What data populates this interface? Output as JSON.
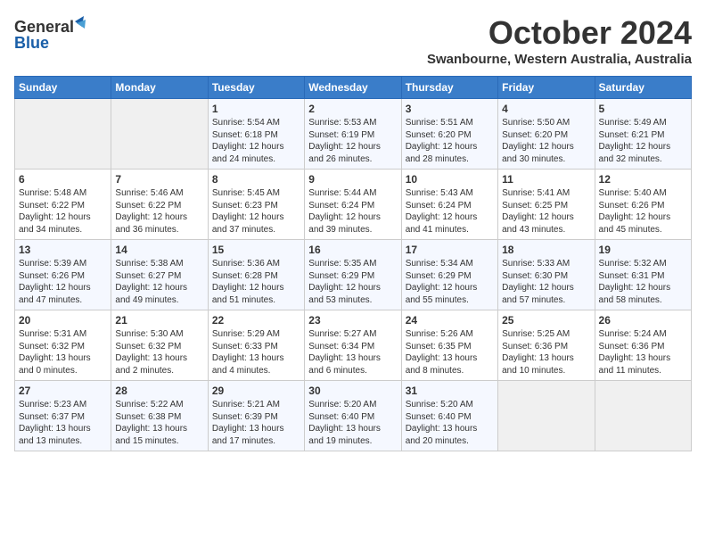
{
  "header": {
    "logo_line1": "General",
    "logo_line2": "Blue",
    "title": "October 2024",
    "subtitle": "Swanbourne, Western Australia, Australia"
  },
  "calendar": {
    "weekdays": [
      "Sunday",
      "Monday",
      "Tuesday",
      "Wednesday",
      "Thursday",
      "Friday",
      "Saturday"
    ],
    "rows": [
      [
        {
          "day": "",
          "detail": ""
        },
        {
          "day": "",
          "detail": ""
        },
        {
          "day": "1",
          "detail": "Sunrise: 5:54 AM\nSunset: 6:18 PM\nDaylight: 12 hours and 24 minutes."
        },
        {
          "day": "2",
          "detail": "Sunrise: 5:53 AM\nSunset: 6:19 PM\nDaylight: 12 hours and 26 minutes."
        },
        {
          "day": "3",
          "detail": "Sunrise: 5:51 AM\nSunset: 6:20 PM\nDaylight: 12 hours and 28 minutes."
        },
        {
          "day": "4",
          "detail": "Sunrise: 5:50 AM\nSunset: 6:20 PM\nDaylight: 12 hours and 30 minutes."
        },
        {
          "day": "5",
          "detail": "Sunrise: 5:49 AM\nSunset: 6:21 PM\nDaylight: 12 hours and 32 minutes."
        }
      ],
      [
        {
          "day": "6",
          "detail": "Sunrise: 5:48 AM\nSunset: 6:22 PM\nDaylight: 12 hours and 34 minutes."
        },
        {
          "day": "7",
          "detail": "Sunrise: 5:46 AM\nSunset: 6:22 PM\nDaylight: 12 hours and 36 minutes."
        },
        {
          "day": "8",
          "detail": "Sunrise: 5:45 AM\nSunset: 6:23 PM\nDaylight: 12 hours and 37 minutes."
        },
        {
          "day": "9",
          "detail": "Sunrise: 5:44 AM\nSunset: 6:24 PM\nDaylight: 12 hours and 39 minutes."
        },
        {
          "day": "10",
          "detail": "Sunrise: 5:43 AM\nSunset: 6:24 PM\nDaylight: 12 hours and 41 minutes."
        },
        {
          "day": "11",
          "detail": "Sunrise: 5:41 AM\nSunset: 6:25 PM\nDaylight: 12 hours and 43 minutes."
        },
        {
          "day": "12",
          "detail": "Sunrise: 5:40 AM\nSunset: 6:26 PM\nDaylight: 12 hours and 45 minutes."
        }
      ],
      [
        {
          "day": "13",
          "detail": "Sunrise: 5:39 AM\nSunset: 6:26 PM\nDaylight: 12 hours and 47 minutes."
        },
        {
          "day": "14",
          "detail": "Sunrise: 5:38 AM\nSunset: 6:27 PM\nDaylight: 12 hours and 49 minutes."
        },
        {
          "day": "15",
          "detail": "Sunrise: 5:36 AM\nSunset: 6:28 PM\nDaylight: 12 hours and 51 minutes."
        },
        {
          "day": "16",
          "detail": "Sunrise: 5:35 AM\nSunset: 6:29 PM\nDaylight: 12 hours and 53 minutes."
        },
        {
          "day": "17",
          "detail": "Sunrise: 5:34 AM\nSunset: 6:29 PM\nDaylight: 12 hours and 55 minutes."
        },
        {
          "day": "18",
          "detail": "Sunrise: 5:33 AM\nSunset: 6:30 PM\nDaylight: 12 hours and 57 minutes."
        },
        {
          "day": "19",
          "detail": "Sunrise: 5:32 AM\nSunset: 6:31 PM\nDaylight: 12 hours and 58 minutes."
        }
      ],
      [
        {
          "day": "20",
          "detail": "Sunrise: 5:31 AM\nSunset: 6:32 PM\nDaylight: 13 hours and 0 minutes."
        },
        {
          "day": "21",
          "detail": "Sunrise: 5:30 AM\nSunset: 6:32 PM\nDaylight: 13 hours and 2 minutes."
        },
        {
          "day": "22",
          "detail": "Sunrise: 5:29 AM\nSunset: 6:33 PM\nDaylight: 13 hours and 4 minutes."
        },
        {
          "day": "23",
          "detail": "Sunrise: 5:27 AM\nSunset: 6:34 PM\nDaylight: 13 hours and 6 minutes."
        },
        {
          "day": "24",
          "detail": "Sunrise: 5:26 AM\nSunset: 6:35 PM\nDaylight: 13 hours and 8 minutes."
        },
        {
          "day": "25",
          "detail": "Sunrise: 5:25 AM\nSunset: 6:36 PM\nDaylight: 13 hours and 10 minutes."
        },
        {
          "day": "26",
          "detail": "Sunrise: 5:24 AM\nSunset: 6:36 PM\nDaylight: 13 hours and 11 minutes."
        }
      ],
      [
        {
          "day": "27",
          "detail": "Sunrise: 5:23 AM\nSunset: 6:37 PM\nDaylight: 13 hours and 13 minutes."
        },
        {
          "day": "28",
          "detail": "Sunrise: 5:22 AM\nSunset: 6:38 PM\nDaylight: 13 hours and 15 minutes."
        },
        {
          "day": "29",
          "detail": "Sunrise: 5:21 AM\nSunset: 6:39 PM\nDaylight: 13 hours and 17 minutes."
        },
        {
          "day": "30",
          "detail": "Sunrise: 5:20 AM\nSunset: 6:40 PM\nDaylight: 13 hours and 19 minutes."
        },
        {
          "day": "31",
          "detail": "Sunrise: 5:20 AM\nSunset: 6:40 PM\nDaylight: 13 hours and 20 minutes."
        },
        {
          "day": "",
          "detail": ""
        },
        {
          "day": "",
          "detail": ""
        }
      ]
    ]
  }
}
